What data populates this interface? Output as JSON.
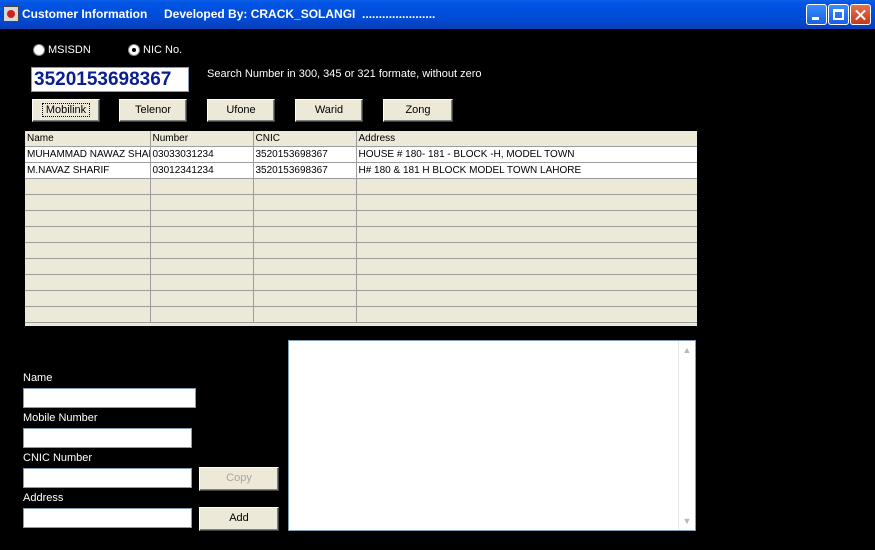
{
  "window": {
    "title": "Customer Information     Developed By: CRACK_SOLANGI  ......................",
    "buttons": {
      "minimize": "minimize-icon",
      "maximize": "maximize-icon",
      "close": "close-icon"
    }
  },
  "search": {
    "options": [
      {
        "label": "MSISDN",
        "selected": false
      },
      {
        "label": "NIC No.",
        "selected": true
      }
    ],
    "value": "3520153698367",
    "hint": "Search Number in 300, 345 or 321 formate, without zero"
  },
  "operators": [
    {
      "label": "Mobilink"
    },
    {
      "label": "Telenor"
    },
    {
      "label": "Ufone"
    },
    {
      "label": "Warid"
    },
    {
      "label": "Zong"
    }
  ],
  "grid": {
    "columns": [
      "Name",
      "Number",
      "CNIC",
      "Address"
    ],
    "rows": [
      [
        "MUHAMMAD NAWAZ SHARIF",
        "03033031234",
        "3520153698367",
        "HOUSE # 180- 181 -  BLOCK -H, MODEL TOWN"
      ],
      [
        "M.NAVAZ SHARIF",
        "03012341234",
        "3520153698367",
        "H# 180 &  181 H BLOCK MODEL TOWN LAHORE"
      ]
    ],
    "empty_rows": 9
  },
  "form": {
    "name_label": "Name",
    "mobile_label": "Mobile Number",
    "cnic_label": "CNIC Number",
    "address_label": "Address",
    "copy_label": "Copy",
    "add_label": "Add"
  }
}
